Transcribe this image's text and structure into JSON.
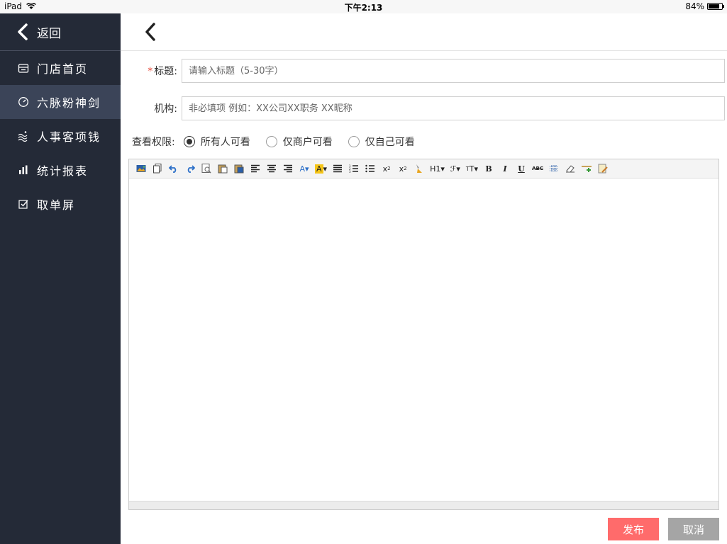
{
  "status": {
    "device": "iPad",
    "time": "下午2:13",
    "battery": "84%"
  },
  "sidebar": {
    "back_label": "返回",
    "items": [
      {
        "label": "门店首页",
        "icon": "store-icon",
        "active": false
      },
      {
        "label": "六脉粉神剑",
        "icon": "gauge-icon",
        "active": true
      },
      {
        "label": "人事客项钱",
        "icon": "wave-icon",
        "active": false
      },
      {
        "label": "统计报表",
        "icon": "bar-chart-icon",
        "active": false
      },
      {
        "label": "取单屏",
        "icon": "checkbox-icon",
        "active": false
      }
    ]
  },
  "form": {
    "title_label": "标题:",
    "title_required_mark": "*",
    "title_placeholder": "请输入标题（5-30字）",
    "org_label": "机构:",
    "org_placeholder": "非必填项 例如：XX公司XX职务 XX昵称",
    "perm_label": "查看权限:",
    "perm_options": [
      "所有人可看",
      "仅商户可看",
      "仅自己可看"
    ],
    "perm_selected": "所有人可看"
  },
  "toolbar": {
    "h1": "H1",
    "bold": "B",
    "italic": "I",
    "underline": "U",
    "strike": "ABC"
  },
  "actions": {
    "publish": "发布",
    "cancel": "取消"
  },
  "colors": {
    "sidebar_bg": "#242a37",
    "active_bg": "#3b4458",
    "publish": "#ff6b6b",
    "cancel": "#a5a5a5"
  }
}
